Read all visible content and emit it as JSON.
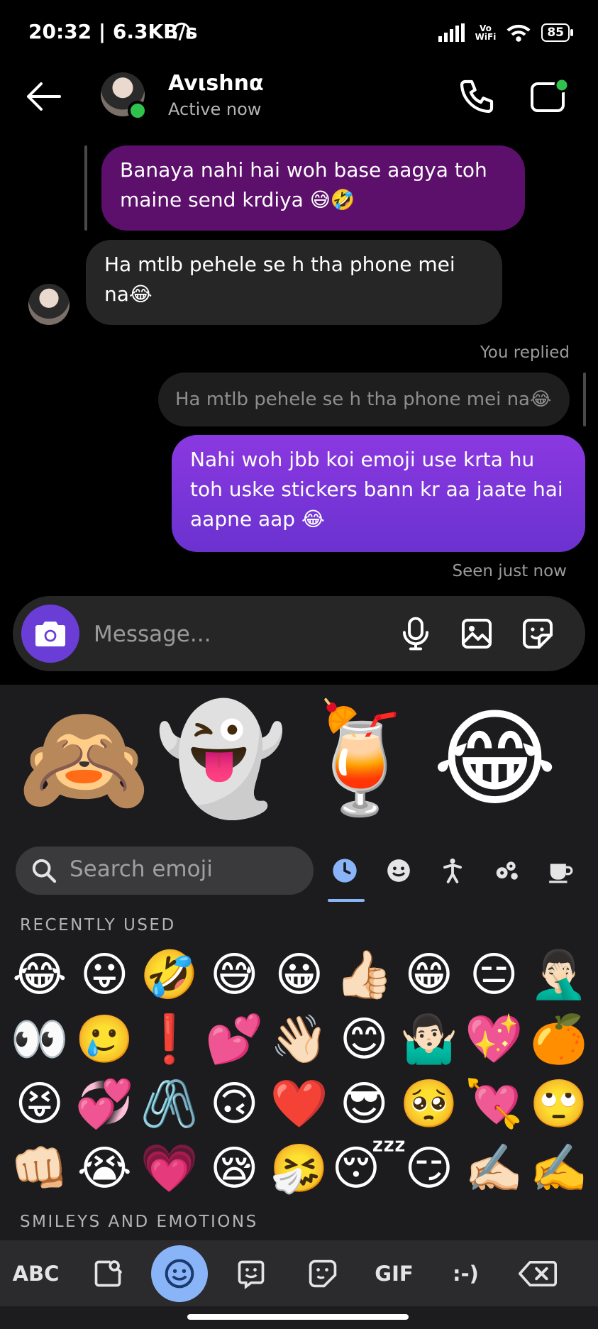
{
  "status_bar": {
    "time_speed": "20:32 | 6.3KB/s",
    "vowifi_top": "Vo",
    "vowifi_bottom": "WiFi",
    "battery": "85"
  },
  "header": {
    "contact_name": "Avιshnα",
    "contact_status": "Active now"
  },
  "messages": {
    "out1": "Banaya nahi hai woh base aagya toh maine send krdiya 😅🤣",
    "in1": "Ha mtlb pehele se h tha phone mei na😂",
    "you_replied": "You replied",
    "reply_quote": "Ha mtlb pehele se h tha phone mei na😂",
    "out2": "Nahi woh jbb koi emoji use krta hu toh uske stickers bann kr aa jaate hai aapne aap 😂",
    "seen": "Seen just now"
  },
  "composer": {
    "placeholder": "Message..."
  },
  "keyboard": {
    "stickers": [
      "🙈",
      "👻",
      "🍹",
      "😂"
    ],
    "search_placeholder": "Search emoji",
    "recently_used_label": "RECENTLY USED",
    "smileys_label": "SMILEYS AND EMOTIONS",
    "recent_emojis": [
      "😂",
      "😛",
      "🤣",
      "😅",
      "😀",
      "👍🏻",
      "😁",
      "😑",
      "🤦🏻‍♂️",
      "👀",
      "🥲",
      "❗",
      "💕",
      "👋🏻",
      "😊",
      "🤷🏻‍♂️",
      "💖",
      "🍊",
      "😝",
      "💞",
      "🖇️",
      "🙃",
      "❤️",
      "😎",
      "🥺",
      "💘",
      "🙄",
      "👊🏻",
      "😭",
      "💗",
      "😪",
      "🤧",
      "😴",
      "😏",
      "✍🏻",
      "✍️"
    ],
    "bottom": {
      "abc": "ABC",
      "gif": "GIF",
      "emoticon": ":-)"
    }
  },
  "colors": {
    "accent_blue": "#8ab4f8",
    "online_green": "#31c24d",
    "outgoing_dark": "#5c0f6b",
    "outgoing_purple": "#7a35d8"
  }
}
